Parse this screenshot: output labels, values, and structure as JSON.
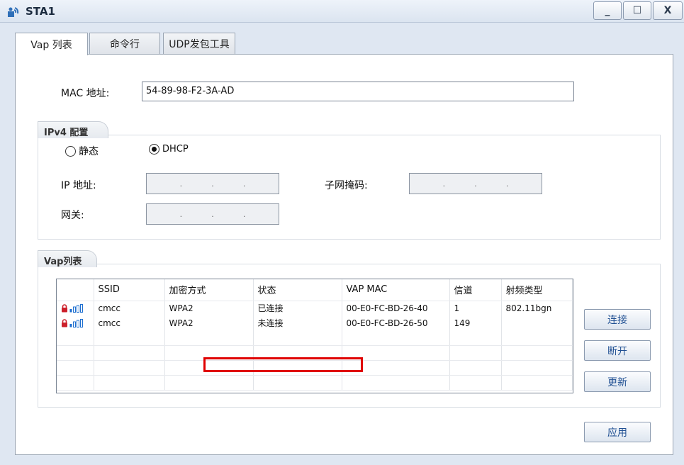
{
  "window": {
    "title": "STA1",
    "minimize_label": "_",
    "maximize_label": "☐",
    "close_label": "X"
  },
  "tabs": [
    {
      "label": "Vap 列表",
      "active": true
    },
    {
      "label": "命令行",
      "active": false
    },
    {
      "label": "UDP发包工具",
      "active": false
    }
  ],
  "mac": {
    "label": "MAC 地址:",
    "value": "54-89-98-F2-3A-AD"
  },
  "ipv4": {
    "group_title": "IPv4 配置",
    "static_label": "静态",
    "dhcp_label": "DHCP",
    "selected": "DHCP",
    "ip_label": "IP 地址:",
    "mask_label": "子网掩码:",
    "gateway_label": "网关:",
    "ip_dot": "."
  },
  "vap": {
    "group_title": "Vap列表",
    "columns": [
      "",
      "SSID",
      "加密方式",
      "状态",
      "VAP MAC",
      "信道",
      "射频类型"
    ],
    "rows": [
      {
        "ssid": "cmcc",
        "encryption": "WPA2",
        "status": "已连接",
        "vap_mac": "00-E0-FC-BD-26-40",
        "channel": "1",
        "radio_type": "802.11bgn"
      },
      {
        "ssid": "cmcc",
        "encryption": "WPA2",
        "status": "未连接",
        "vap_mac": "00-E0-FC-BD-26-50",
        "channel": "149",
        "radio_type": ""
      }
    ]
  },
  "buttons": {
    "connect": "连接",
    "disconnect": "断开",
    "refresh": "更新",
    "apply": "应用"
  },
  "colors": {
    "accent_text": "#1f4f92",
    "highlight": "#e00000",
    "signal": "#1e6fd0",
    "lock": "#cc1f2a"
  }
}
